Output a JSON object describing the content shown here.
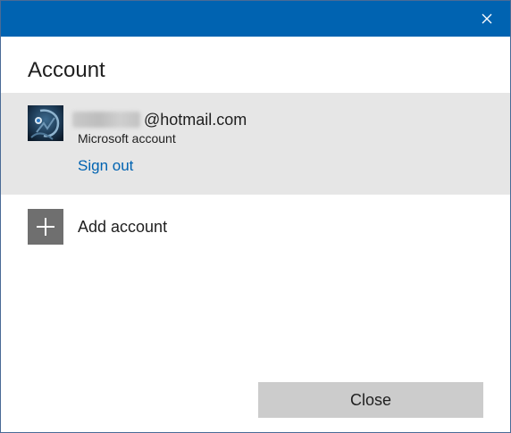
{
  "window": {
    "titlebar_color": "#0063b1",
    "close_icon": "close-icon"
  },
  "heading": "Account",
  "account": {
    "email_visible_suffix": "@hotmail.com",
    "email_prefix_obscured": true,
    "type": "Microsoft account",
    "sign_out_label": "Sign out",
    "avatar_icon": "user-avatar",
    "row_background": "#e6e6e6",
    "link_color": "#0063b1"
  },
  "add_account": {
    "label": "Add account",
    "icon": "plus-icon"
  },
  "footer": {
    "close_label": "Close"
  }
}
